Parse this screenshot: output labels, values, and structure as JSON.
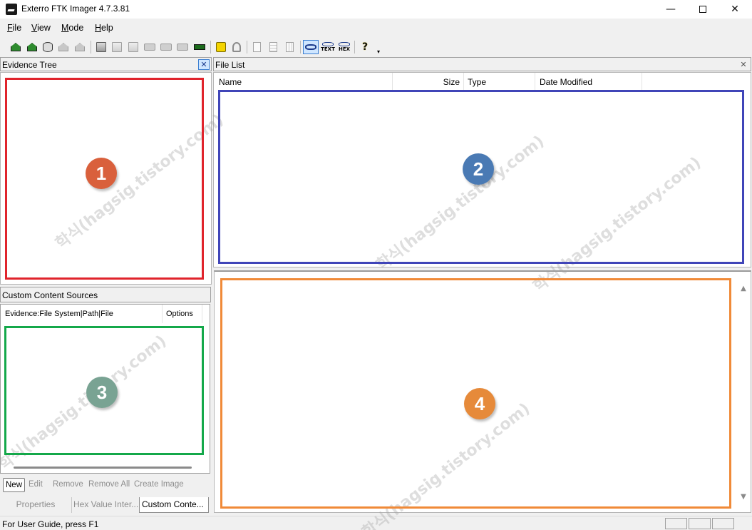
{
  "window": {
    "title": "Exterro FTK Imager 4.7.3.81",
    "minimize": "—",
    "close": "✕"
  },
  "menu": [
    "File",
    "View",
    "Mode",
    "Help"
  ],
  "toolbar_icons": [
    "add-evidence-icon",
    "add-all-evidence-icon",
    "image-mounting-icon",
    "remove-evidence-icon",
    "remove-all-evidence-icon",
    "create-disk-image-icon",
    "export-disk-image-icon",
    "export-logical-image-icon",
    "add-to-custom-content-icon",
    "create-custom-content-icon",
    "decrypt-icon",
    "capture-memory-icon",
    "obtain-protected-files-icon",
    "detect-encryption-icon",
    "export-files-icon",
    "export-hash-list-icon",
    "export-directory-listing-icon",
    "auto-view-icon",
    "text-view-icon",
    "hex-view-icon",
    "help-icon"
  ],
  "toolbar_labels": {
    "text": "TEXT",
    "hex": "HEX",
    "help": "?",
    "dropdown": "▾"
  },
  "evidence_tree": {
    "header": "Evidence Tree",
    "close": "✕"
  },
  "file_list": {
    "header": "File List",
    "close": "✕",
    "columns": [
      "Name",
      "Size",
      "Type",
      "Date Modified"
    ]
  },
  "custom_content": {
    "header": "Custom Content Sources",
    "columns": [
      "Evidence:File System|Path|File",
      "Options"
    ],
    "buttons": [
      "New",
      "Edit",
      "Remove",
      "Remove All",
      "Create Image"
    ]
  },
  "bottom_tabs": [
    "Properties",
    "Hex Value Inter...",
    "Custom Conte..."
  ],
  "status": {
    "text": "For User Guide, press F1"
  },
  "viewer": {
    "scroll_up": "▲",
    "scroll_down": "▼"
  },
  "annotations": {
    "labels": [
      "1",
      "2",
      "3",
      "4"
    ],
    "colors": {
      "1": "#e0242c",
      "2": "#4045b8",
      "3": "#14a84a",
      "4": "#f08a38"
    },
    "circle_colors": {
      "1": "#d9603c",
      "2": "#4a7ab4",
      "3": "#79a393",
      "4": "#e68a3a"
    }
  },
  "watermark": "학식(hagsig.tistory.com)"
}
